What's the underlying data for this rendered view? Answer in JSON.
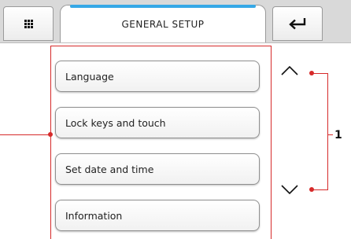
{
  "header": {
    "title": "GENERAL SETUP",
    "menu_icon": "grid-icon",
    "back_icon": "return-arrow-icon",
    "accent_color": "#36a8e6"
  },
  "menu": {
    "items": [
      {
        "label": "Language"
      },
      {
        "label": "Lock keys and touch"
      },
      {
        "label": "Set date and time"
      },
      {
        "label": "Information"
      }
    ],
    "scroll_up_icon": "chevron-up-icon",
    "scroll_down_icon": "chevron-down-icon"
  },
  "annotation": {
    "callout_label": "1",
    "line_color": "#d62a2a"
  }
}
